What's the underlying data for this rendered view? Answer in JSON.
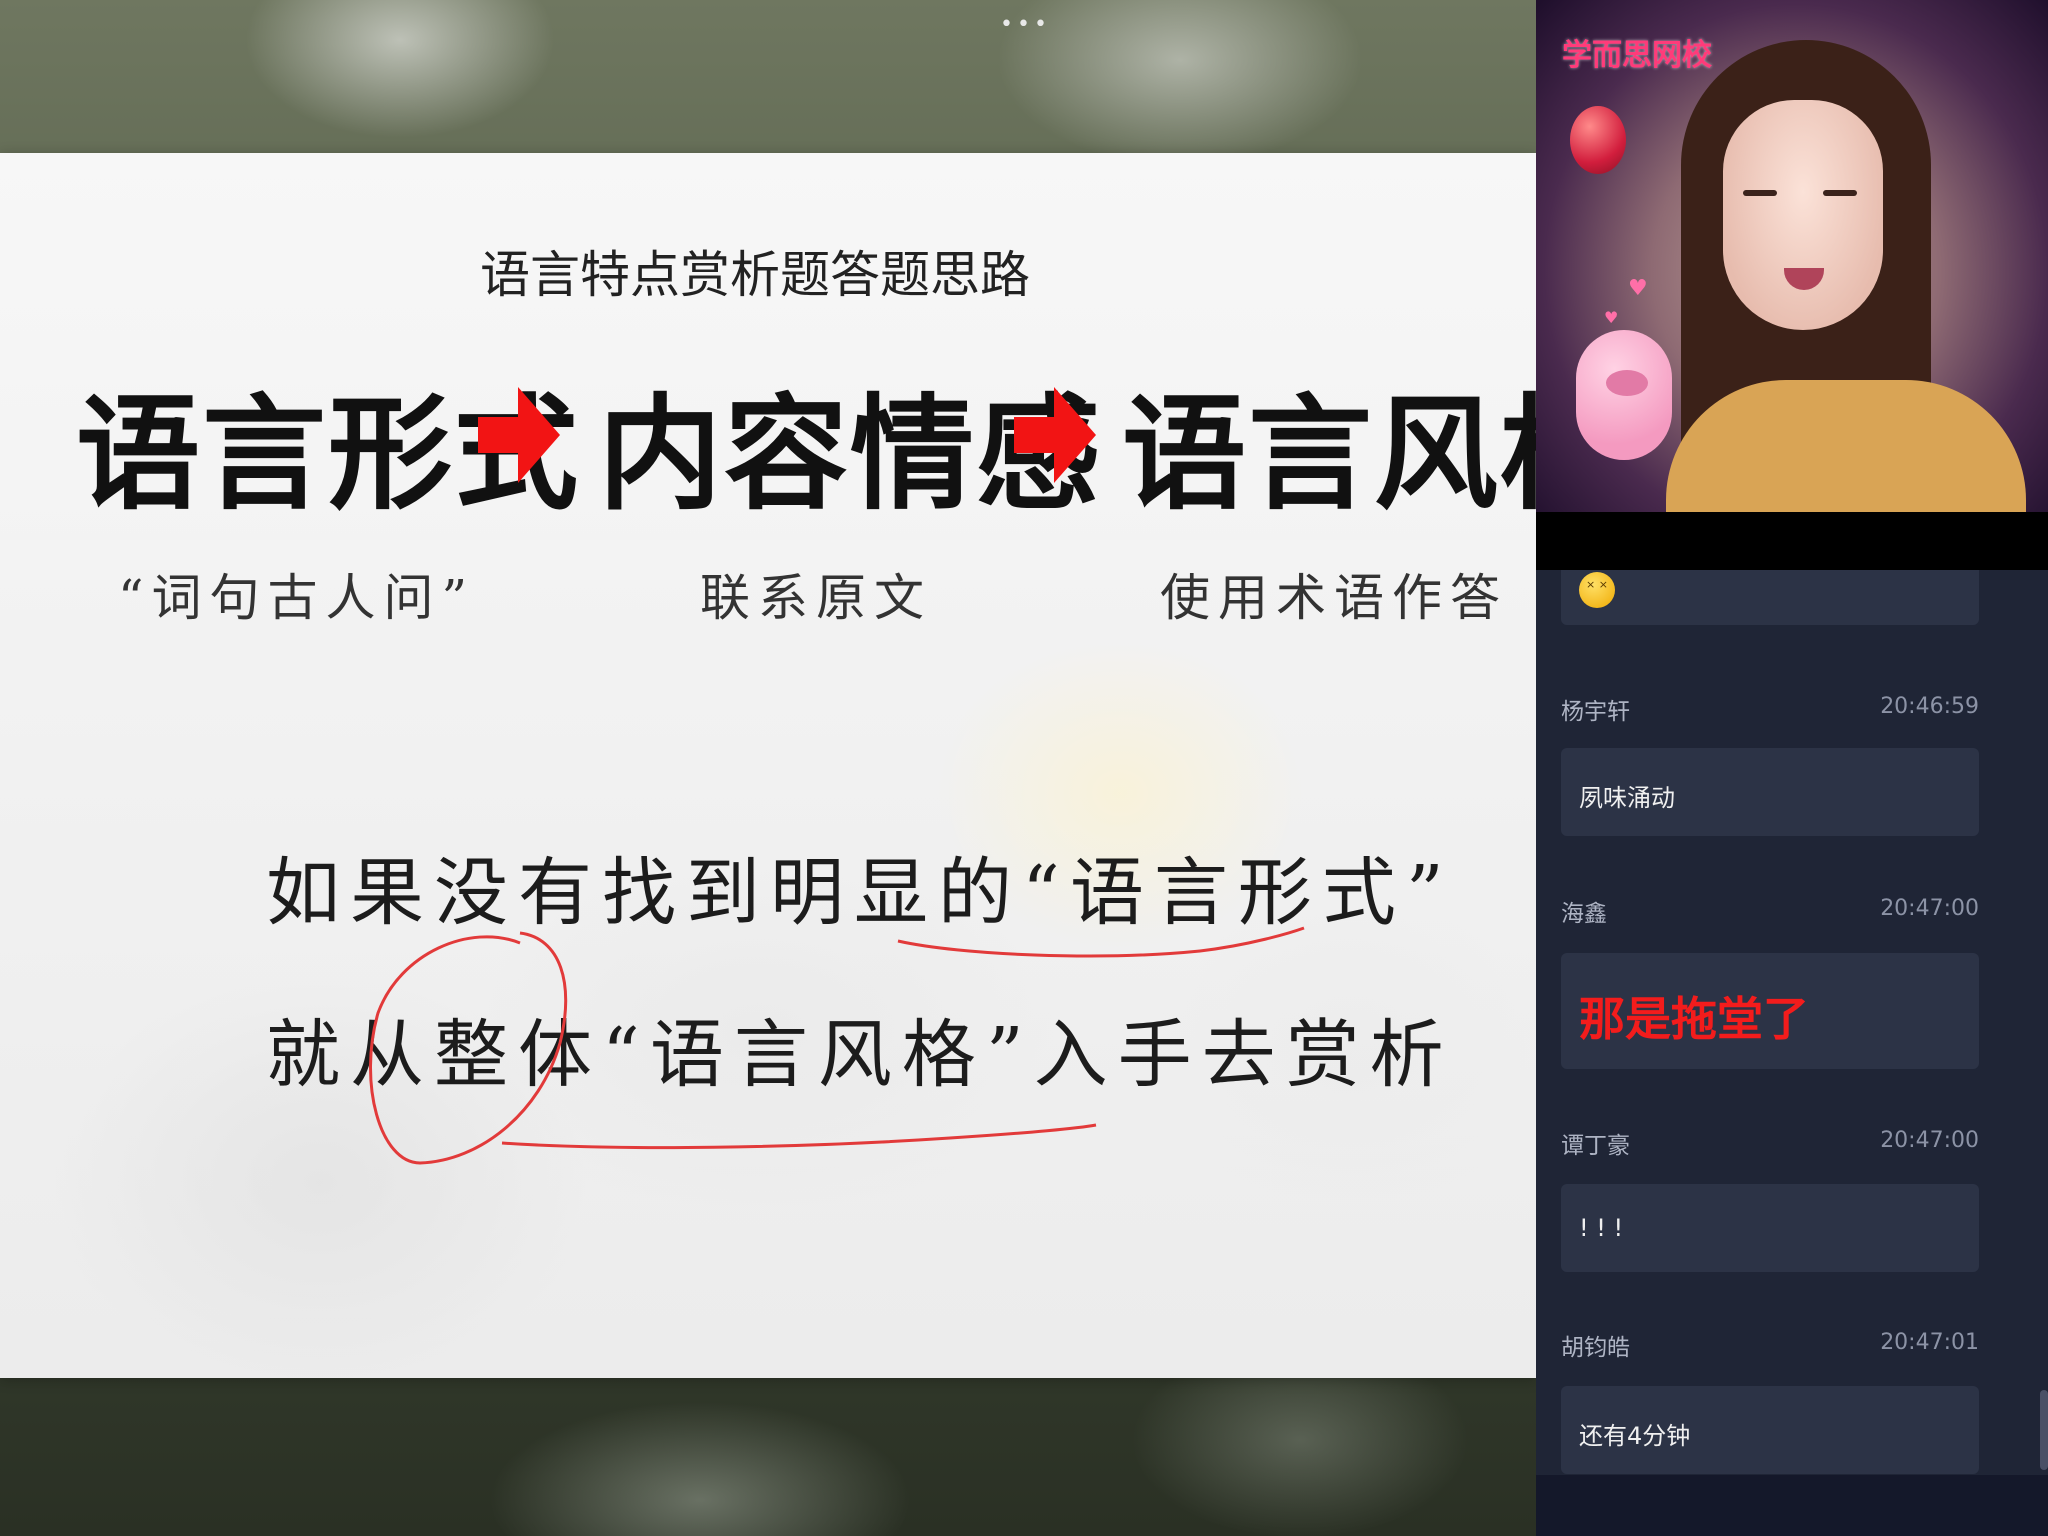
{
  "window": {
    "more_menu": "•••"
  },
  "slide": {
    "subtitle": "语言特点赏析题答题思路",
    "concepts": [
      "语言形式",
      "内容情感",
      "语言风格"
    ],
    "notes": [
      "“词句古人问”",
      "联系原文",
      "使用术语作答"
    ],
    "handwriting": {
      "line1": "如果没有找到明显的“语言形式”",
      "line2": "就从整体“语言风格”入手去赏析"
    },
    "arrow_color": "#f21414",
    "annotation_color": "#e23a3a"
  },
  "camera": {
    "logo": "学而思网校"
  },
  "chat": {
    "messages": [
      {
        "name": "",
        "time": "",
        "text": "",
        "emoji": "dizzy-face-icon"
      },
      {
        "name": "杨宇轩",
        "time": "20:46:59",
        "text": "夙味涌动"
      },
      {
        "name": "海鑫",
        "time": "20:47:00",
        "text": "那是拖堂了",
        "highlight": true
      },
      {
        "name": "谭丁豪",
        "time": "20:47:00",
        "text": "! ! !"
      },
      {
        "name": "胡钧皓",
        "time": "20:47:01",
        "text": "还有4分钟"
      }
    ]
  }
}
